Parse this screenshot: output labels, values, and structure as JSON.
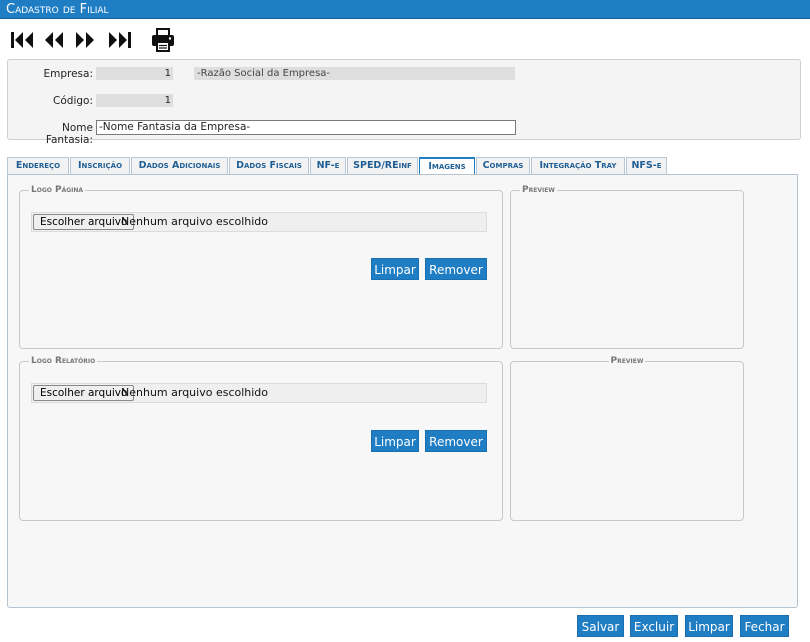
{
  "window": {
    "title": "Cadastro de Filial"
  },
  "toolbar": {
    "icons": [
      "first-record-icon",
      "previous-record-icon",
      "next-record-icon",
      "last-record-icon",
      "printer-icon"
    ]
  },
  "header": {
    "empresa": {
      "label": "Empresa:",
      "code": "1",
      "name": "-Razão Social da Empresa-"
    },
    "codigo": {
      "label": "Código:",
      "value": "1"
    },
    "nome_fantasia": {
      "label": "Nome Fantasia:",
      "value": "-Nome Fantasia da Empresa-"
    }
  },
  "tabs": [
    {
      "label": "Endereço"
    },
    {
      "label": "Inscrição"
    },
    {
      "label": "Dados Adicionais"
    },
    {
      "label": "Dados Fiscais"
    },
    {
      "label": "NF-e"
    },
    {
      "label": "SPED/REinf"
    },
    {
      "label": "Imagens",
      "active": true
    },
    {
      "label": "Compras"
    },
    {
      "label": "Integração Tray"
    },
    {
      "label": "NFS-e"
    }
  ],
  "logo_pagina": {
    "legend": "Logo Página",
    "file_button": "Escolher arquivo",
    "file_status": "Nenhum arquivo escolhido",
    "clear_button": "Limpar",
    "remove_button": "Remover",
    "preview_legend": "Preview"
  },
  "logo_relatorio": {
    "legend": "Logo Relatório",
    "file_button": "Escolher arquivo",
    "file_status": "Nenhum arquivo escolhido",
    "clear_button": "Limpar",
    "remove_button": "Remover",
    "preview_legend": "Preview"
  },
  "footer": {
    "save": "Salvar",
    "delete": "Excluir",
    "clear": "Limpar",
    "close": "Fechar"
  },
  "colors": {
    "accent": "#1f7dc4",
    "panel": "#f7f7f7"
  }
}
